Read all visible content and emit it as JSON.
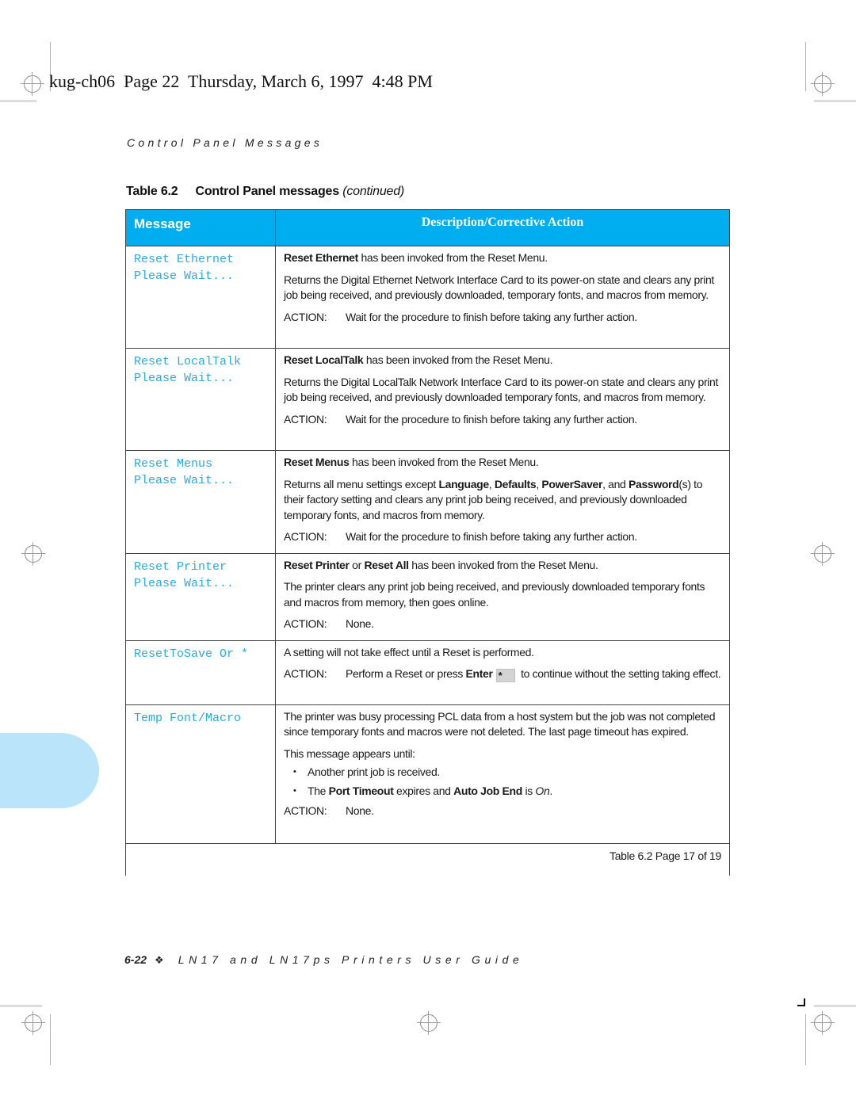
{
  "slug": "kug-ch06  Page 22  Thursday, March 6, 1997  4:48 PM",
  "running_head": "Control Panel Messages",
  "table": {
    "number": "Table 6.2",
    "title": "Control Panel messages",
    "continued": "(continued)",
    "headers": {
      "message": "Message",
      "description": "Description/Corrective Action"
    },
    "header_color": "#00aeef",
    "message_text_color": "#29a9e8",
    "rows": [
      {
        "message": [
          "Reset Ethernet",
          "Please Wait..."
        ],
        "intro_bold": "Reset Ethernet",
        "intro_rest": " has been invoked from the Reset Menu.",
        "detail": "Returns the Digital Ethernet Network Interface Card to its power-on state and clears any print job being received, and previously downloaded, temporary fonts, and macros from memory.",
        "action_label": "ACTION:",
        "action": "Wait for the procedure to finish before taking any further action."
      },
      {
        "message": [
          "Reset LocalTalk",
          "Please Wait..."
        ],
        "intro_bold": "Reset LocalTalk",
        "intro_rest": " has been invoked from the Reset Menu.",
        "detail": "Returns the Digital LocalTalk Network Interface Card to its power-on state and clears any print job being received, and previously downloaded temporary fonts, and macros from memory.",
        "action_label": "ACTION:",
        "action": "Wait for the procedure to finish before taking any further action."
      },
      {
        "message": [
          "Reset Menus",
          "Please Wait..."
        ],
        "intro_bold": "Reset Menus",
        "intro_rest": " has been invoked from the Reset Menu.",
        "detail_parts": {
          "p1": "Returns all menu settings except ",
          "b1": "Language",
          "p2": ", ",
          "b2": "Defaults",
          "p3": ", ",
          "b3": "PowerSaver",
          "p4": ", and ",
          "b4": "Password",
          "p5": "(s) to their factory setting and clears any print job being received, and previously downloaded temporary fonts, and macros from memory."
        },
        "action_label": "ACTION:",
        "action": "Wait for the procedure to finish before taking any further action."
      },
      {
        "message": [
          "Reset Printer",
          "Please Wait..."
        ],
        "intro_bold": "Reset Printer",
        "intro_mid": " or ",
        "intro_bold2": "Reset All",
        "intro_rest": " has been invoked from the Reset Menu.",
        "detail": "The printer clears any print job being received, and previously downloaded temporary fonts and macros from memory, then goes online.",
        "action_label": "ACTION:",
        "action": "None."
      },
      {
        "message": [
          "ResetToSave Or *"
        ],
        "intro": "A setting will not take effect until a Reset is performed.",
        "action_label": "ACTION:",
        "action_pre": "Perform a Reset or press ",
        "action_bold": "Enter",
        "action_key": "*",
        "action_post": " to continue without the setting taking effect."
      },
      {
        "message": [
          "Temp Font/Macro"
        ],
        "intro": "The printer was busy processing PCL data from a host system but the job was not completed since temporary fonts and macros were not deleted. The last page timeout has expired.",
        "until": "This message appears until:",
        "bullet1": "Another print job is received.",
        "bullet2_pre": "The ",
        "bullet2_b1": "Port Timeout",
        "bullet2_mid": " expires and ",
        "bullet2_b2": "Auto Job End",
        "bullet2_is": " is ",
        "bullet2_italic": "On",
        "bullet2_end": ".",
        "action_label": "ACTION:",
        "action": "None."
      }
    ],
    "footer": "Table 6.2  Page 17 of 19"
  },
  "side_tab_color": "#b9e4f9",
  "page_footer": {
    "page_number": "6-22",
    "separator": "❖",
    "title": "LN17 and LN17ps Printers User Guide"
  }
}
